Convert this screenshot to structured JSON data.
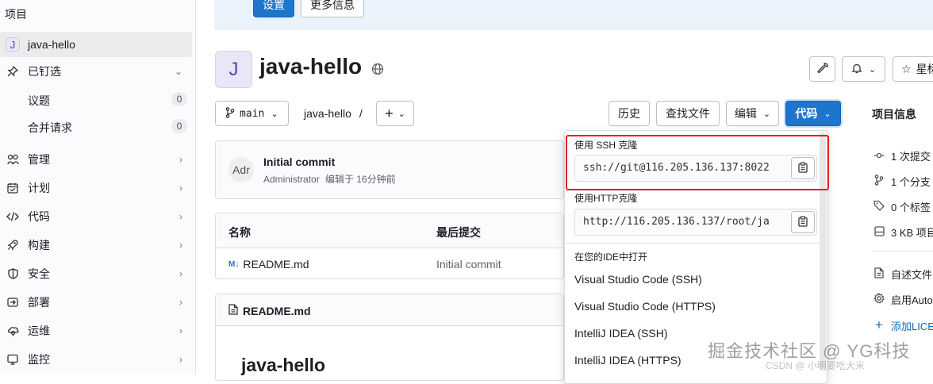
{
  "sidebar": {
    "section_title": "项目",
    "project_item": {
      "avatar_letter": "J",
      "label": "java-hello"
    },
    "pinned": {
      "label": "已钉选",
      "children": [
        {
          "label": "议题",
          "count": "0"
        },
        {
          "label": "合并请求",
          "count": "0"
        }
      ]
    },
    "items": [
      {
        "label": "管理",
        "icon": "manage-icon"
      },
      {
        "label": "计划",
        "icon": "plan-icon"
      },
      {
        "label": "代码",
        "icon": "code-icon"
      },
      {
        "label": "构建",
        "icon": "build-icon"
      },
      {
        "label": "安全",
        "icon": "shield-icon"
      },
      {
        "label": "部署",
        "icon": "deploy-icon"
      },
      {
        "label": "运维",
        "icon": "operate-icon"
      },
      {
        "label": "监控",
        "icon": "monitor-icon"
      }
    ]
  },
  "alert": {
    "settings_label": "设置",
    "more_info_label": "更多信息"
  },
  "project": {
    "avatar_letter": "J",
    "title": "java-hello",
    "visibility_icon": "globe-icon",
    "star_label": "星标"
  },
  "repo_nav": {
    "branch": "main",
    "breadcrumb": "java-hello",
    "breadcrumb_sep": "/",
    "history_label": "历史",
    "find_file_label": "查找文件",
    "edit_label": "编辑",
    "code_label": "代码"
  },
  "commit": {
    "avatar_alt": "Adr",
    "title": "Initial commit",
    "author": "Administrator",
    "meta": "编辑于 16分钟前"
  },
  "file_table": {
    "headers": [
      "名称",
      "最后提交"
    ],
    "rows": [
      {
        "name": "README.md",
        "last_commit": "Initial commit"
      }
    ]
  },
  "readme": {
    "header": "README.md",
    "heading": "java-hello"
  },
  "clone_dropdown": {
    "ssh_label": "使用 SSH 克隆",
    "ssh_url": "ssh://git@116.205.136.137:8022",
    "http_label": "使用HTTP克隆",
    "http_url": "http://116.205.136.137/root/ja",
    "ide_label": "在您的IDE中打开",
    "ide_items": [
      "Visual Studio Code (SSH)",
      "Visual Studio Code (HTTPS)",
      "IntelliJ IDEA (SSH)",
      "IntelliJ IDEA (HTTPS)"
    ]
  },
  "project_info": {
    "title": "项目信息",
    "stats": [
      {
        "icon": "commit-icon",
        "text": "1 次提交"
      },
      {
        "icon": "branch-icon",
        "text": "1 个分支"
      },
      {
        "icon": "tag-icon",
        "text": "0 个标签"
      },
      {
        "icon": "storage-icon",
        "text": "3 KB 项目"
      }
    ],
    "links": [
      {
        "icon": "file-icon",
        "text": "自述文件"
      },
      {
        "icon": "settings-icon",
        "text": "启用Auto"
      },
      {
        "icon": "plus-icon",
        "text": "添加LICE"
      }
    ]
  },
  "watermark": {
    "main": "掘金技术社区 @ YG科技",
    "sub": "CSDN @ 小明要吃大米"
  },
  "colors": {
    "primary": "#1f75cb",
    "highlight_box": "#e32121",
    "avatar_bg": "#e9e6f7"
  }
}
